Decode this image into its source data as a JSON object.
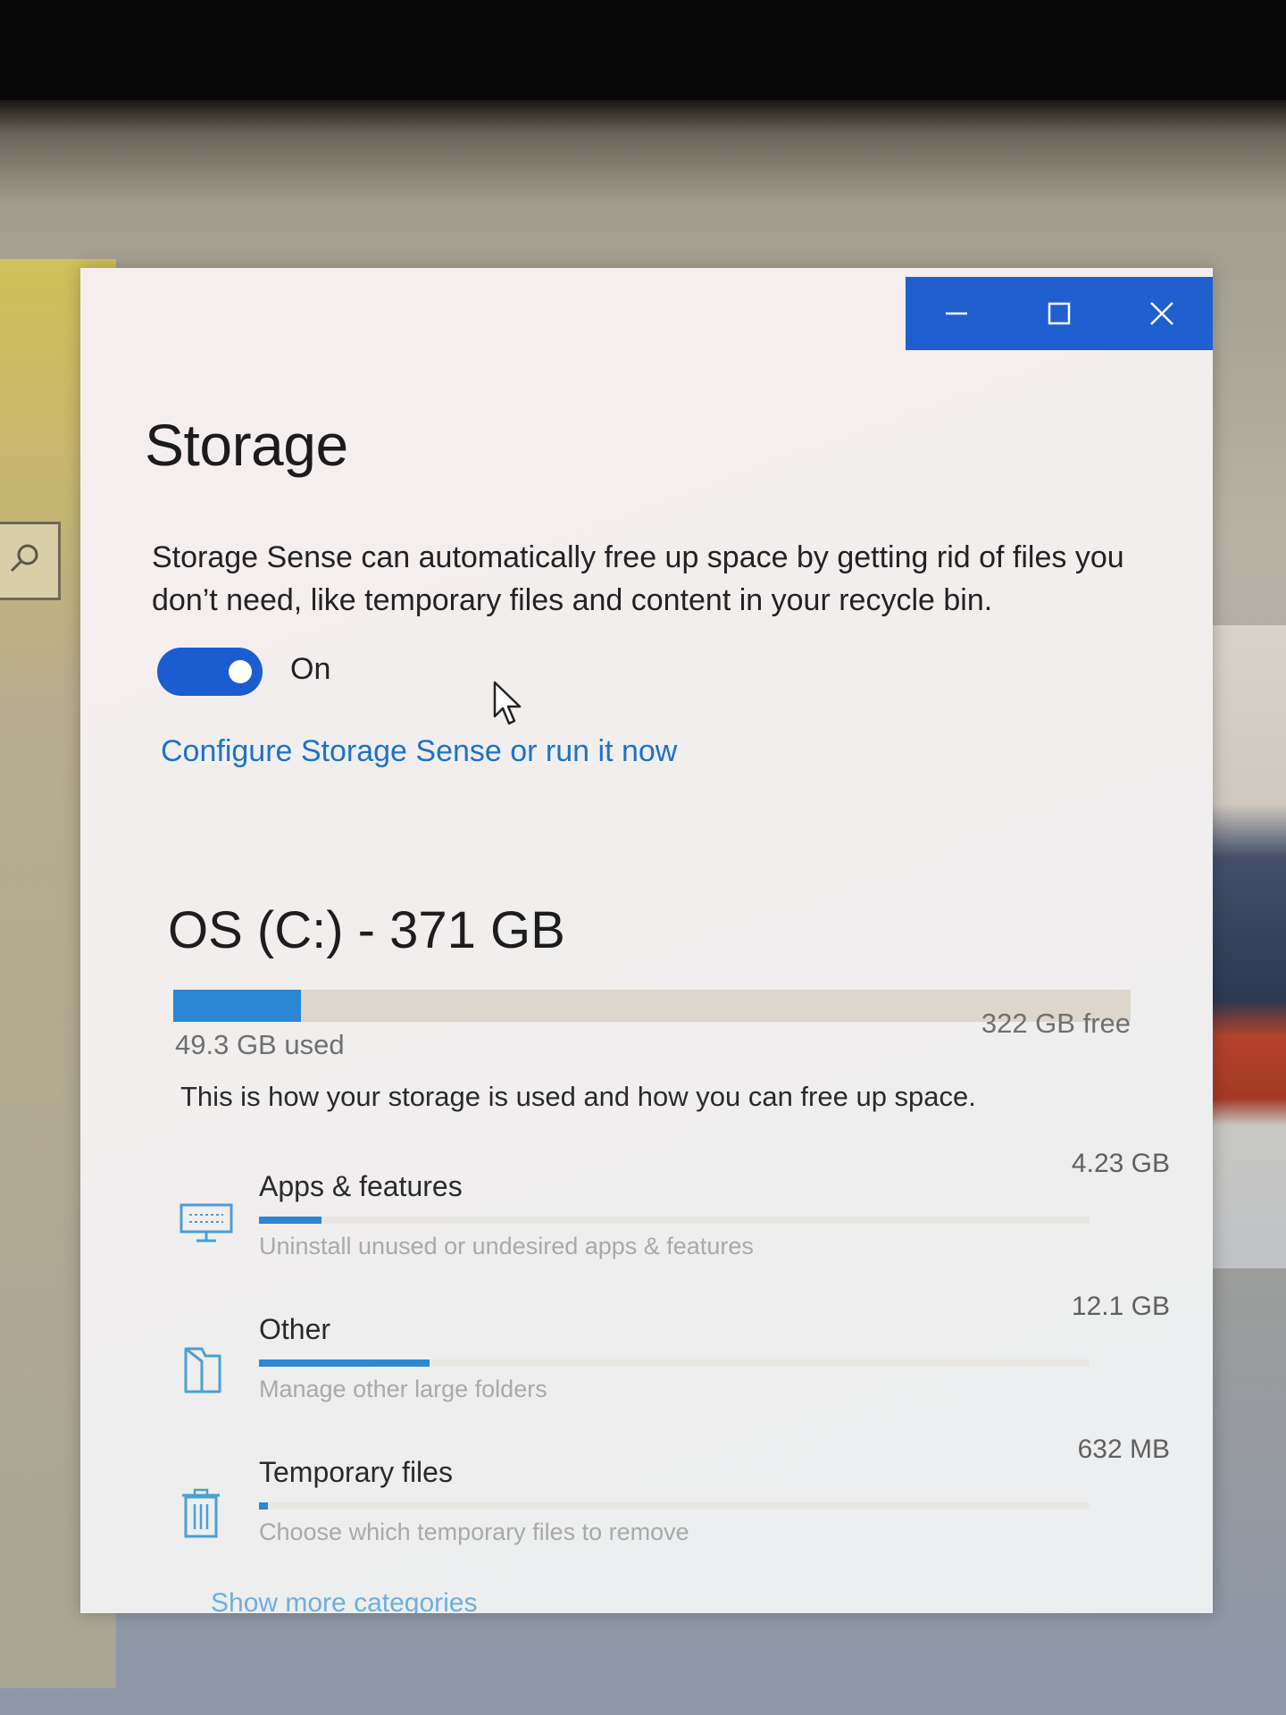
{
  "window": {
    "controls": [
      {
        "name": "minimize-button",
        "icon": "minimize-icon"
      },
      {
        "name": "maximize-button",
        "icon": "maximize-icon"
      },
      {
        "name": "close-button",
        "icon": "close-icon"
      }
    ],
    "accent_color": "#1f5fd0"
  },
  "page": {
    "title": "Storage"
  },
  "storage_sense": {
    "description": "Storage Sense can automatically free up space by getting rid of files you don’t need, like temporary files and content in your recycle bin.",
    "toggle_state": "On",
    "toggle_on": true,
    "config_link": "Configure Storage Sense or run it now"
  },
  "drive": {
    "title": "OS (C:) - 371 GB",
    "used_label": "49.3 GB used",
    "free_label": "322 GB free",
    "used_fraction": 0.133
  },
  "usage": {
    "description": "This is how your storage is used and how you can free up space.",
    "categories": [
      {
        "name": "Apps & features",
        "size": "4.23 GB",
        "desc": "Uninstall unused or undesired apps & features",
        "icon": "monitor-icon",
        "fraction": 0.075
      },
      {
        "name": "Other",
        "size": "12.1 GB",
        "desc": "Manage other large folders",
        "icon": "folder-icon",
        "fraction": 0.205
      },
      {
        "name": "Temporary files",
        "size": "632 MB",
        "desc": "Choose which temporary files to remove",
        "icon": "trash-icon",
        "fraction": 0.011
      }
    ],
    "show_more": "Show more categories"
  }
}
